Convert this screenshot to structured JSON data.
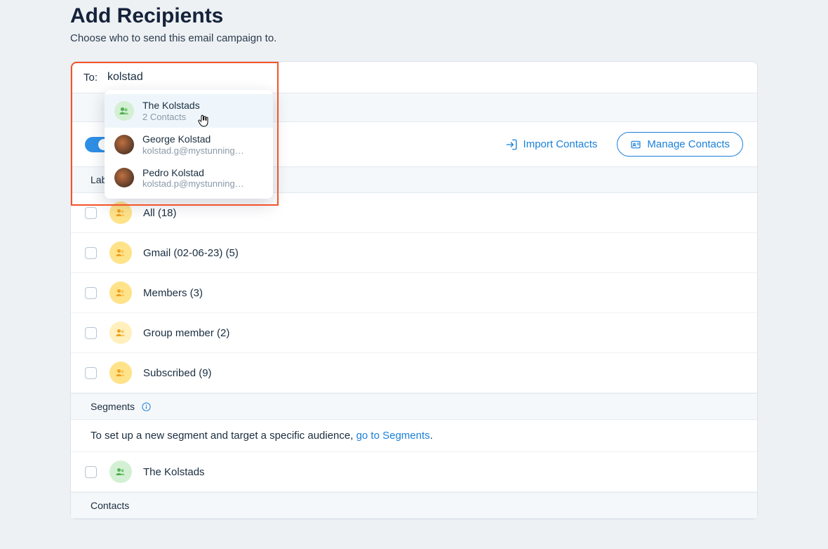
{
  "header": {
    "title": "Add Recipients",
    "subtitle": "Choose who to send this email campaign to."
  },
  "to": {
    "label": "To:",
    "value": "kolstad"
  },
  "suggestions": [
    {
      "title": "The Kolstads",
      "sub": "2 Contacts",
      "avatar": "group-green",
      "hovered": true
    },
    {
      "title": "George Kolstad",
      "sub": "kolstad.g@mystunning…",
      "avatar": "photo",
      "hovered": false
    },
    {
      "title": "Pedro Kolstad",
      "sub": "kolstad.p@mystunning…",
      "avatar": "photo",
      "hovered": false
    }
  ],
  "actions": {
    "import_label": "Import Contacts",
    "manage_label": "Manage Contacts"
  },
  "labels_header": "Lab",
  "label_rows": [
    {
      "label": "All (18)"
    },
    {
      "label": "Gmail (02-06-23) (5)"
    },
    {
      "label": "Members (3)"
    },
    {
      "label": "Group member (2)"
    },
    {
      "label": "Subscribed (9)"
    }
  ],
  "segments_header": "Segments",
  "segments_message_prefix": "To set up a new segment and target a specific audience, ",
  "segments_link": "go to Segments",
  "segments_message_suffix": ".",
  "segments_rows": [
    {
      "label": "The Kolstads"
    }
  ],
  "contacts_header": "Contacts"
}
